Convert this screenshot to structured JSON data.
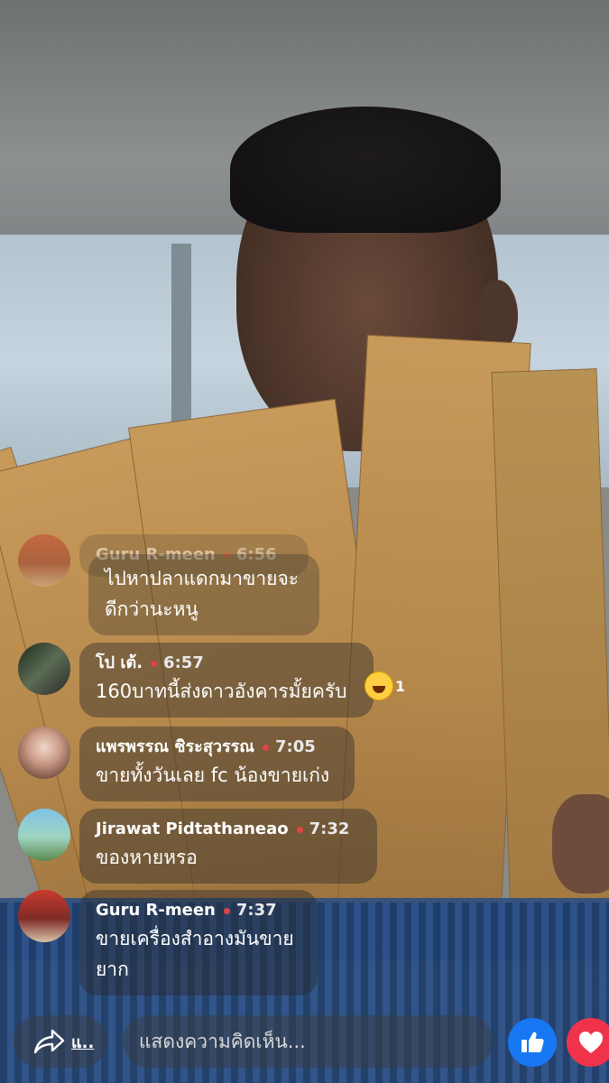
{
  "comments": [
    {
      "name": "Guru R-meen",
      "time": "6:56",
      "text": "ไปหาปลาแดกมาขายจะ\nดีกว่านะหนู"
    },
    {
      "name": "โป เต้.",
      "time": "6:57",
      "text": "160บาทนี้ส่งดาวอังคารมั้ยครับ",
      "reaction": {
        "icon": "haha-emoji-icon",
        "count": "1"
      }
    },
    {
      "name": "แพรพรรณ ชิระสุวรรณ",
      "time": "7:05",
      "text": "ขายทั้งวันเลย fc น้องขายเก่ง"
    },
    {
      "name": "Jirawat Pidtathaneao",
      "time": "7:32",
      "text": "ของหายหรอ"
    },
    {
      "name": "Guru R-meen",
      "time": "7:37",
      "text": "ขายเครื่องสำอางมันขาย\nยาก"
    }
  ],
  "bottom_bar": {
    "share_label": "แ..",
    "comment_placeholder": "แสดงความคิดเห็น...",
    "like_icon": "thumbs-up-icon",
    "love_icon": "heart-icon"
  },
  "colors": {
    "like": "#1877f2",
    "love": "#f0334b",
    "time_dot": "#e04343"
  }
}
